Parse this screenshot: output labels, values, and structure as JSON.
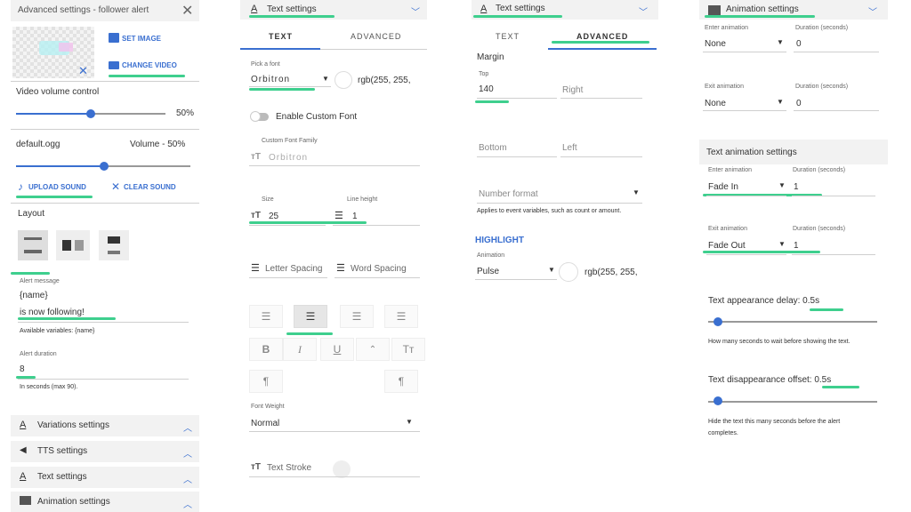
{
  "panel1": {
    "title": "Advanced settings - follower alert",
    "set_image": "SET IMAGE",
    "change_video": "CHANGE VIDEO",
    "video_volume_label": "Video volume control",
    "video_volume_value": "50%",
    "video_volume_level": 0.5,
    "sound_file": "default.ogg",
    "sound_volume": "Volume - 50%",
    "sound_volume_level": 0.5,
    "upload_sound": "UPLOAD SOUND",
    "clear_sound": "CLEAR SOUND",
    "layout_label": "Layout",
    "alert_message_label": "Alert message",
    "alert_message_line1": "{name}",
    "alert_message_line2": "is now following!",
    "available_vars": "Available variables: {name}",
    "alert_duration_label": "Alert duration",
    "alert_duration_value": "8",
    "alert_duration_help": "In seconds (max 90).",
    "sections": [
      "Variations settings",
      "TTS settings",
      "Text settings",
      "Animation settings"
    ]
  },
  "panel2": {
    "header": "Text settings",
    "tab_text": "TEXT",
    "tab_advanced": "ADVANCED",
    "pick_font_label": "Pick a font",
    "font_value": "Orbitron",
    "font_color": "rgb(255, 255,",
    "custom_font_toggle": "Enable Custom Font",
    "custom_font_family_label": "Custom Font Family",
    "custom_font_family_placeholder": "Orbitron",
    "size_label": "Size",
    "size_value": "25",
    "line_height_label": "Line height",
    "line_height_value": "1",
    "letter_spacing": "Letter Spacing",
    "word_spacing": "Word Spacing",
    "font_weight_label": "Font Weight",
    "font_weight_value": "Normal",
    "text_stroke": "Text Stroke"
  },
  "panel3": {
    "header": "Text settings",
    "tab_text": "TEXT",
    "tab_advanced": "ADVANCED",
    "margin_label": "Margin",
    "top_label": "Top",
    "top_value": "140",
    "right_placeholder": "Right",
    "bottom_placeholder": "Bottom",
    "left_placeholder": "Left",
    "number_format_placeholder": "Number format",
    "number_format_help": "Applies to event variables, such as count or amount.",
    "highlight_label": "HIGHLIGHT",
    "animation_label": "Animation",
    "animation_value": "Pulse",
    "highlight_color": "rgb(255, 255,"
  },
  "panel4": {
    "header": "Animation settings",
    "enter_animation_label": "Enter animation",
    "enter_animation_value": "None",
    "duration_label": "Duration (seconds)",
    "enter_duration_value": "0",
    "exit_animation_label": "Exit animation",
    "exit_animation_value": "None",
    "exit_duration_value": "0",
    "text_animation_header": "Text animation settings",
    "text_enter_label": "Enter animation",
    "text_enter_value": "Fade In",
    "text_enter_duration": "1",
    "text_exit_label": "Exit animation",
    "text_exit_value": "Fade Out",
    "text_exit_duration": "1",
    "appearance_delay_label": "Text appearance delay: 0.5s",
    "appearance_delay_help": "How many seconds to wait before showing the text.",
    "disappearance_offset_label": "Text disappearance offset: 0.5s",
    "disappearance_offset_help": "Hide the text this many seconds before the alert",
    "disappearance_offset_help2": "completes."
  },
  "colors": {
    "accent": "#3a6fd0",
    "highlight_green": "#3ecf8e"
  }
}
